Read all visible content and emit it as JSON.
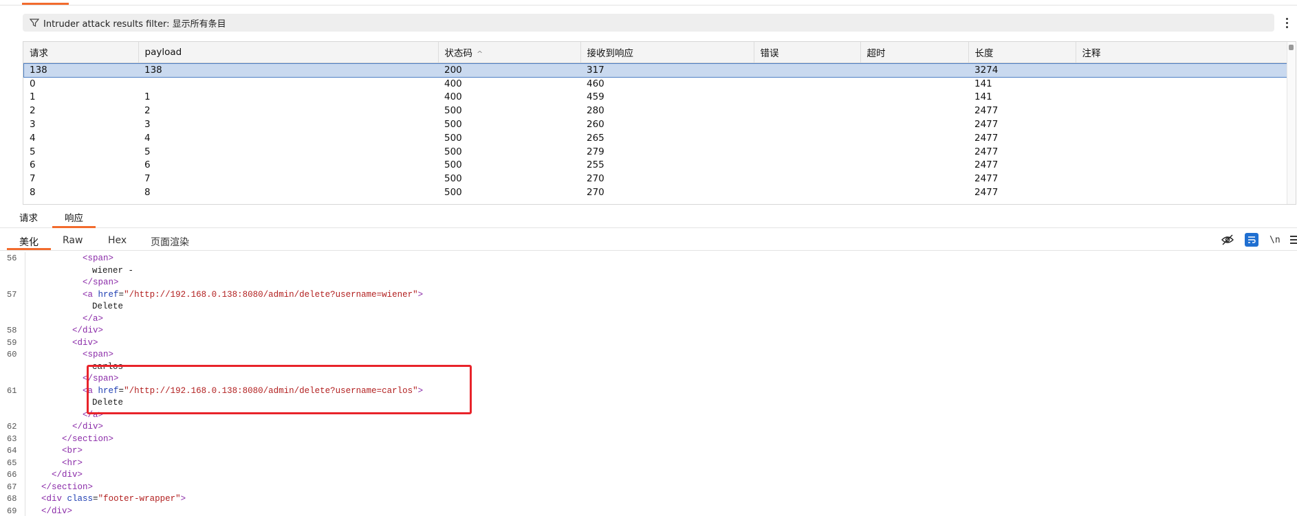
{
  "filter": {
    "label": "Intruder attack results filter: 显示所有条目",
    "icon": "filter-icon"
  },
  "table": {
    "columns": [
      "请求",
      "payload",
      "状态码",
      "接收到响应",
      "错误",
      "超时",
      "长度",
      "注释"
    ],
    "sorted_column": "状态码",
    "sort_direction": "ascending",
    "rows": [
      [
        "138",
        "138",
        "200",
        "317",
        "",
        "",
        "3274",
        ""
      ],
      [
        "0",
        "",
        "400",
        "460",
        "",
        "",
        "141",
        ""
      ],
      [
        "1",
        "1",
        "400",
        "459",
        "",
        "",
        "141",
        ""
      ],
      [
        "2",
        "2",
        "500",
        "280",
        "",
        "",
        "2477",
        ""
      ],
      [
        "3",
        "3",
        "500",
        "260",
        "",
        "",
        "2477",
        ""
      ],
      [
        "4",
        "4",
        "500",
        "265",
        "",
        "",
        "2477",
        ""
      ],
      [
        "5",
        "5",
        "500",
        "279",
        "",
        "",
        "2477",
        ""
      ],
      [
        "6",
        "6",
        "500",
        "255",
        "",
        "",
        "2477",
        ""
      ],
      [
        "7",
        "7",
        "500",
        "270",
        "",
        "",
        "2477",
        ""
      ],
      [
        "8",
        "8",
        "500",
        "270",
        "",
        "",
        "2477",
        ""
      ]
    ]
  },
  "message_tabs": {
    "request": "请求",
    "response": "响应"
  },
  "view_tabs": {
    "pretty": "美化",
    "raw": "Raw",
    "hex": "Hex",
    "render": "页面渲染"
  },
  "toolbar": {
    "newline_label": "\\n"
  },
  "code": {
    "l1": "56",
    "l2": "",
    "l3": "",
    "l4": "57",
    "l5": "",
    "l6": "",
    "l7": "58",
    "l8": "59",
    "l9": "60",
    "l10": "",
    "l11": "",
    "l12": "61",
    "l13": "",
    "l14": "",
    "l15": "62",
    "l16": "63",
    "l17": "64",
    "l18": "65",
    "l19": "66",
    "l20": "67",
    "l21": "68",
    "l22": "69",
    "span_open": "<span>",
    "span_close": "</span>",
    "a_open": "<a",
    "a_close": "</a>",
    "div_open": "<div>",
    "div_close": "</div>",
    "section_close": "</section>",
    "br": "<br>",
    "hr": "<hr>",
    "href_attr": "href",
    "eq": "=",
    "wiener_text": "wiener -",
    "carlos_text": "carlos -",
    "delete_text": "Delete",
    "href_wiener": "\"/http://192.168.0.138:8080/admin/delete?username=wiener\"",
    "href_carlos": "\"/http://192.168.0.138:8080/admin/delete?username=carlos\"",
    "gt": ">",
    "div_tag_open": "<div",
    "class_attr": "class",
    "footer_val": "\"footer-wrapper\""
  }
}
